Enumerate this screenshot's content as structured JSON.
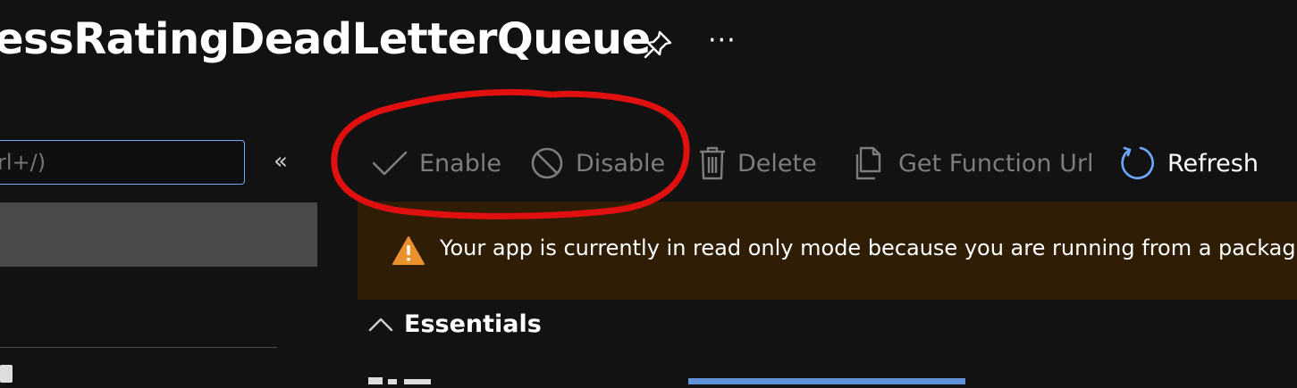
{
  "header": {
    "title": "essRatingDeadLetterQueue",
    "more_label": "···"
  },
  "sidebar": {
    "search_placeholder": "rl+/)",
    "collapse_label": "«"
  },
  "toolbar": {
    "enable_label": "Enable",
    "disable_label": "Disable",
    "delete_label": "Delete",
    "get_url_label": "Get Function Url",
    "refresh_label": "Refresh"
  },
  "banner": {
    "text": "Your app is currently in read only mode because you are running from a package"
  },
  "essentials": {
    "label": "Essentials"
  },
  "colors": {
    "background": "#121212",
    "banner_bg": "#301d06",
    "warning_icon": "#e8912d",
    "accent_blue": "#6ea8ff",
    "annotation_red": "#e01010",
    "disabled_text": "#7d7d7d"
  }
}
